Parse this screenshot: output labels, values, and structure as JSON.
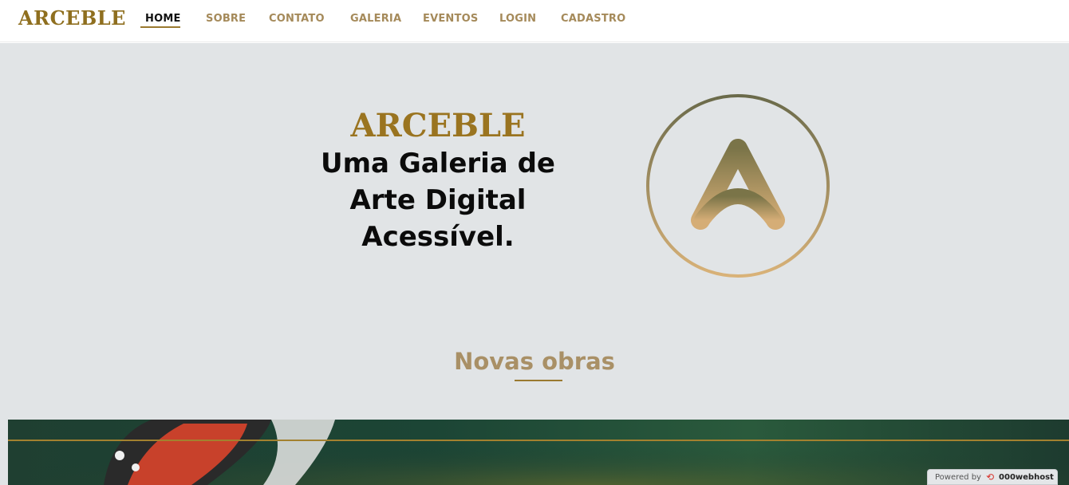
{
  "nav": {
    "brand": "ARCEBLE",
    "items": [
      {
        "label": "HOME",
        "active": true
      },
      {
        "label": "SOBRE"
      },
      {
        "label": "CONTATO"
      },
      {
        "label": "GALERIA"
      },
      {
        "label": "EVENTOS"
      },
      {
        "label": "LOGIN"
      },
      {
        "label": "CADASTRO"
      }
    ]
  },
  "hero": {
    "title": "ARCEBLE",
    "subtitle_lines": [
      "Uma Galeria de",
      "Arte Digital",
      "Acessível."
    ]
  },
  "section": {
    "title": "Novas obras"
  },
  "footer_badge": {
    "prefix": "Powered by",
    "brand": "000webhost",
    "icon": "000webhost-logo-icon"
  },
  "colors": {
    "brand_gold": "#8f6f1f",
    "nav_link": "#a58a5a",
    "hero_bg": "#e1e4e6",
    "section_title": "#a99066"
  }
}
